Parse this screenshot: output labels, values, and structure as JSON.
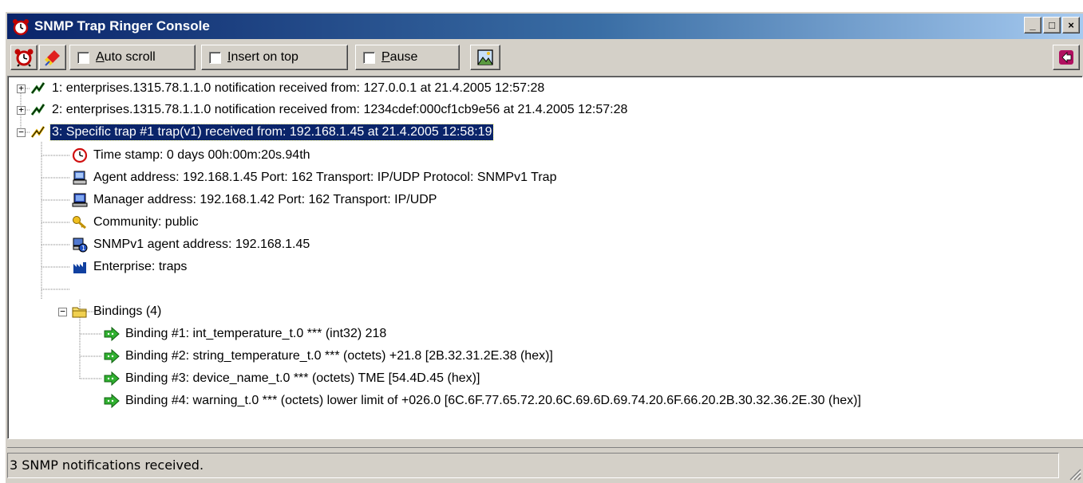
{
  "window": {
    "title": "SNMP Trap Ringer Console",
    "controls": {
      "minimize": "_",
      "maximize": "□",
      "close": "×"
    }
  },
  "toolbar": {
    "alarm_icon": "alarm-clock-icon",
    "clear_icon": "eraser-brush-icon",
    "auto_scroll": {
      "label_pre": "",
      "mnemonic": "A",
      "label_post": "uto scroll",
      "checked": false
    },
    "insert_on_top": {
      "label_pre": "",
      "mnemonic": "I",
      "label_post": "nsert on top",
      "checked": false
    },
    "pause": {
      "label_pre": "",
      "mnemonic": "P",
      "label_post": "ause",
      "checked": false
    },
    "settings_icon": "image-settings-icon",
    "exit_icon": "exit-arrow-icon"
  },
  "tree": {
    "notifications": [
      {
        "text": "1: enterprises.1315.78.1.1.0 notification received from: 127.0.0.1 at 21.4.2005 12:57:28",
        "expanded": false,
        "selected": false
      },
      {
        "text": "2: enterprises.1315.78.1.1.0 notification received from: 1234cdef:000cf1cb9e56 at 21.4.2005 12:57:28",
        "expanded": false,
        "selected": false
      },
      {
        "text": "3: Specific trap #1 trap(v1) received from: 192.168.1.45 at 21.4.2005 12:58:19",
        "expanded": true,
        "selected": true
      }
    ],
    "details": [
      {
        "icon": "clock-icon",
        "text": "Time stamp: 0 days 00h:00m:20s.94th"
      },
      {
        "icon": "agent-computer-icon",
        "text": "Agent address: 192.168.1.45 Port: 162 Transport: IP/UDP Protocol: SNMPv1 Trap"
      },
      {
        "icon": "manager-computer-icon",
        "text": "Manager address: 192.168.1.42 Port: 162 Transport: IP/UDP"
      },
      {
        "icon": "key-icon",
        "text": "Community: public"
      },
      {
        "icon": "snmp-agent-icon",
        "text": "SNMPv1 agent address: 192.168.1.45"
      },
      {
        "icon": "enterprise-chart-icon",
        "text": "Enterprise: traps"
      }
    ],
    "bindings_folder": {
      "text": "Bindings (4)",
      "expanded": true
    },
    "bindings": [
      "Binding #1: int_temperature_t.0 *** (int32) 218",
      "Binding #2: string_temperature_t.0 *** (octets) +21.8 [2B.32.31.2E.38 (hex)]",
      "Binding #3: device_name_t.0 *** (octets) TME [54.4D.45 (hex)]",
      "Binding #4: warning_t.0 *** (octets) lower limit of +026.0 [6C.6F.77.65.72.20.6C.69.6D.69.74.20.6F.66.20.2B.30.32.36.2E.30 (hex)]"
    ]
  },
  "status": {
    "text": "3 SNMP notifications received."
  },
  "colors": {
    "title_start": "#0a246a",
    "title_end": "#a6caf0",
    "selection": "#0a246a",
    "face": "#d4d0c8"
  }
}
